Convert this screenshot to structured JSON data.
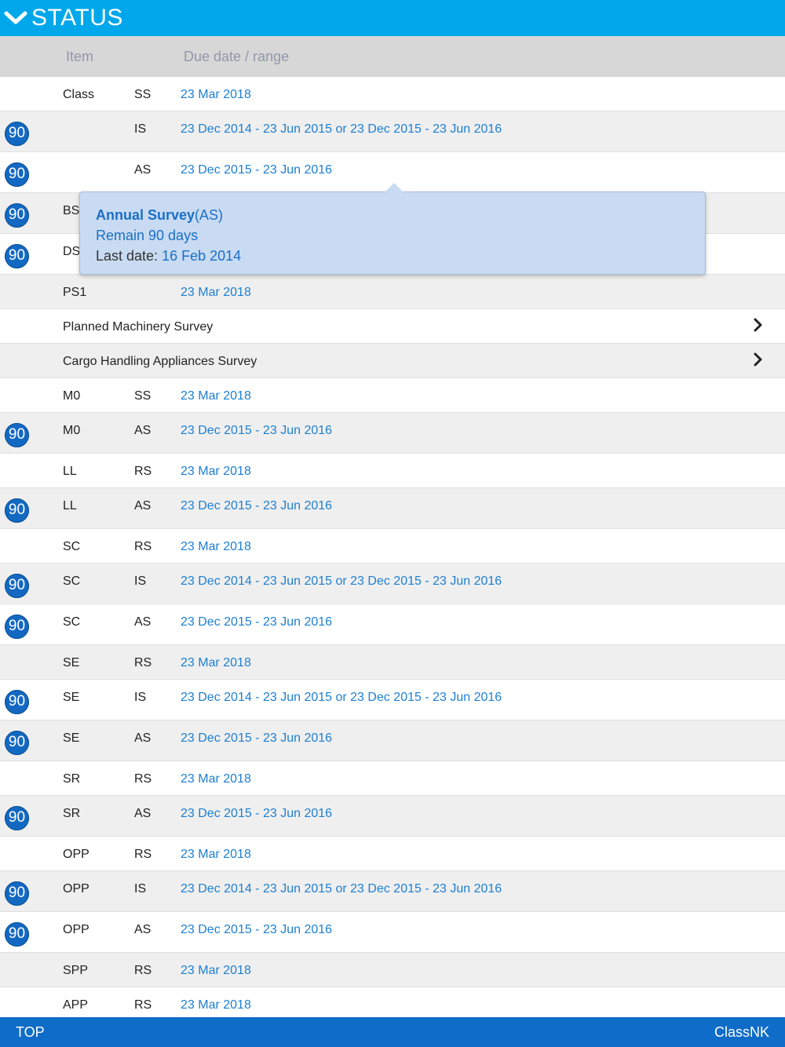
{
  "header": {
    "title": "STATUS"
  },
  "columns": {
    "item": "Item",
    "due": "Due date / range"
  },
  "badge_text": "90",
  "rows": [
    {
      "item": "Class",
      "type": "SS",
      "due": "23 Mar 2018",
      "badge": false,
      "h": 44
    },
    {
      "item": "",
      "type": "IS",
      "due": "23 Dec 2014 - 23 Jun 2015 or 23 Dec 2015 - 23 Jun 2016",
      "badge": true,
      "h": 52
    },
    {
      "item": "",
      "type": "AS",
      "due": "23 Dec 2015 - 23 Jun 2016",
      "badge": true,
      "h": 52
    },
    {
      "item": "BS",
      "type": "",
      "due": "",
      "badge": true,
      "h": 52
    },
    {
      "item": "DS",
      "type": "",
      "due": "",
      "badge": true,
      "h": 52
    },
    {
      "item": "PS1",
      "type": "",
      "due": "23 Mar 2018",
      "badge": false,
      "h": 44
    },
    {
      "item": "Planned Machinery Survey",
      "type": "",
      "due": "",
      "badge": false,
      "chevron": true,
      "h": 44
    },
    {
      "item": "Cargo Handling Appliances Survey",
      "type": "",
      "due": "",
      "badge": false,
      "chevron": true,
      "h": 44
    },
    {
      "item": "M0",
      "type": "SS",
      "due": "23 Mar 2018",
      "badge": false,
      "h": 44
    },
    {
      "item": "M0",
      "type": "AS",
      "due": "23 Dec 2015 - 23 Jun 2016",
      "badge": true,
      "h": 52
    },
    {
      "item": "LL",
      "type": "RS",
      "due": "23 Mar 2018",
      "badge": false,
      "h": 44
    },
    {
      "item": "LL",
      "type": "AS",
      "due": "23 Dec 2015 - 23 Jun 2016",
      "badge": true,
      "h": 52
    },
    {
      "item": "SC",
      "type": "RS",
      "due": "23 Mar 2018",
      "badge": false,
      "h": 44
    },
    {
      "item": "SC",
      "type": "IS",
      "due": "23 Dec 2014 - 23 Jun 2015 or 23 Dec 2015 - 23 Jun 2016",
      "badge": true,
      "h": 52
    },
    {
      "item": "SC",
      "type": "AS",
      "due": "23 Dec 2015 - 23 Jun 2016",
      "badge": true,
      "h": 52
    },
    {
      "item": "SE",
      "type": "RS",
      "due": "23 Mar 2018",
      "badge": false,
      "h": 44
    },
    {
      "item": "SE",
      "type": "IS",
      "due": "23 Dec 2014 - 23 Jun 2015 or 23 Dec 2015 - 23 Jun 2016",
      "badge": true,
      "h": 52
    },
    {
      "item": "SE",
      "type": "AS",
      "due": "23 Dec 2015 - 23 Jun 2016",
      "badge": true,
      "h": 52
    },
    {
      "item": "SR",
      "type": "RS",
      "due": "23 Mar 2018",
      "badge": false,
      "h": 44
    },
    {
      "item": "SR",
      "type": "AS",
      "due": "23 Dec 2015 - 23 Jun 2016",
      "badge": true,
      "h": 52
    },
    {
      "item": "OPP",
      "type": "RS",
      "due": "23 Mar 2018",
      "badge": false,
      "h": 44
    },
    {
      "item": "OPP",
      "type": "IS",
      "due": "23 Dec 2014 - 23 Jun 2015 or 23 Dec 2015 - 23 Jun 2016",
      "badge": true,
      "h": 52
    },
    {
      "item": "OPP",
      "type": "AS",
      "due": "23 Dec 2015 - 23 Jun 2016",
      "badge": true,
      "h": 52
    },
    {
      "item": "SPP",
      "type": "RS",
      "due": "23 Mar 2018",
      "badge": false,
      "h": 44
    },
    {
      "item": "APP",
      "type": "RS",
      "due": "23 Mar 2018",
      "badge": false,
      "h": 44
    }
  ],
  "tooltip": {
    "title": "Annual Survey",
    "title_suffix": "(AS)",
    "remain": "Remain 90 days",
    "last_label": "Last date: ",
    "last_date": "16 Feb 2014"
  },
  "footer": {
    "top": "TOP",
    "brand": "ClassNK"
  },
  "colors": {
    "header": "#00a7ea",
    "footer": "#0f6cc8",
    "badge": "#1369c2",
    "link": "#1e7fd0"
  }
}
